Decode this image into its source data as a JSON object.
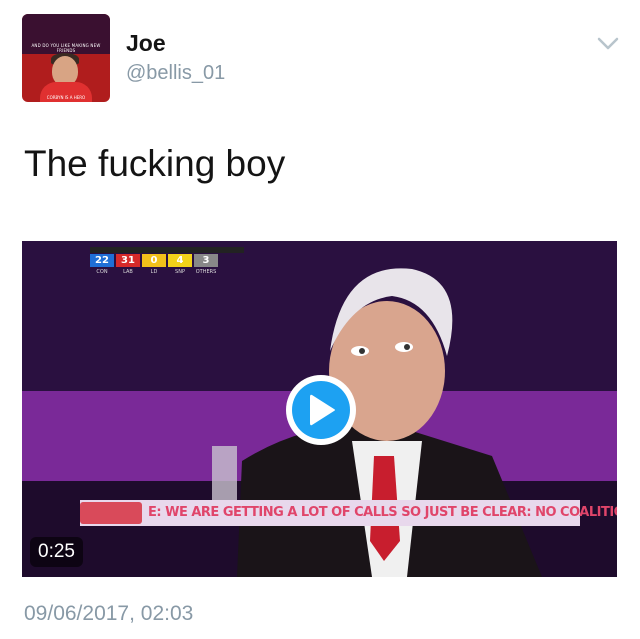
{
  "author": {
    "name": "Joe",
    "handle": "@bellis_01",
    "avatar_caption_top": "AND DO YOU LIKE MAKING NEW FRIENDS",
    "avatar_caption_bottom": "CORBYN IS A HERO"
  },
  "tweet": {
    "text": "The fucking boy",
    "timestamp": "09/06/2017, 02:03"
  },
  "video": {
    "duration": "0:25",
    "scoreboard": {
      "values": [
        "22",
        "31",
        "0",
        "4",
        "3"
      ],
      "labels": [
        "CON",
        "LAB",
        "LD",
        "SNP",
        "OTHERS"
      ],
      "colors": [
        "#1f6fd6",
        "#d62a2a",
        "#f2c01a",
        "#f2d21a",
        "#888888"
      ]
    },
    "ticker_text": "E: WE ARE GETTING A LOT OF CALLS SO JUST BE CLEAR: NO COALITION. N"
  },
  "icons": {
    "menu": "chevron-down-icon",
    "play": "play-icon"
  },
  "colors": {
    "accent": "#1da1f2",
    "secondary_text": "#8899a6",
    "primary_text": "#141414"
  }
}
